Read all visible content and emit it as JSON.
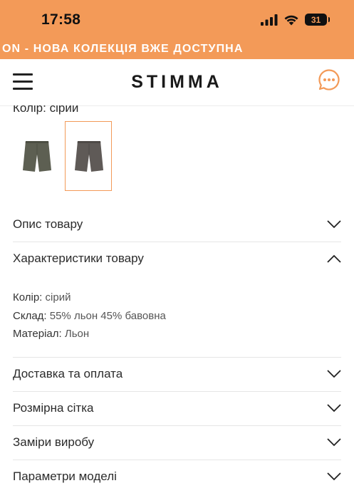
{
  "status_bar": {
    "time": "17:58",
    "battery": "31"
  },
  "promo": {
    "ticker_text": "ON - НОВА КОЛЕКЦІЯ ВЖЕ ДОСТУПНА"
  },
  "header": {
    "logo": "STIMMA"
  },
  "product": {
    "color_label": "Колір:",
    "color_value": "сірий",
    "swatches": [
      {
        "name": "olive-green",
        "color": "#5d5f52",
        "selected": false
      },
      {
        "name": "grey",
        "color": "#5f5a57",
        "selected": true
      }
    ]
  },
  "accordion": {
    "description": "Опис товару",
    "characteristics": "Характеристики товару",
    "delivery": "Доставка та оплата",
    "size_chart": "Розмірна сітка",
    "measurements": "Заміри виробу",
    "model_params": "Параметри моделі"
  },
  "specs": {
    "color_key": "Колір:",
    "color_val": "сірий",
    "composition_key": "Склад:",
    "composition_val": "55% льон 45% бавовна",
    "material_key": "Матеріал:",
    "material_val": "Льон"
  },
  "colors": {
    "accent": "#f39a58",
    "text": "#2b2b2b"
  }
}
